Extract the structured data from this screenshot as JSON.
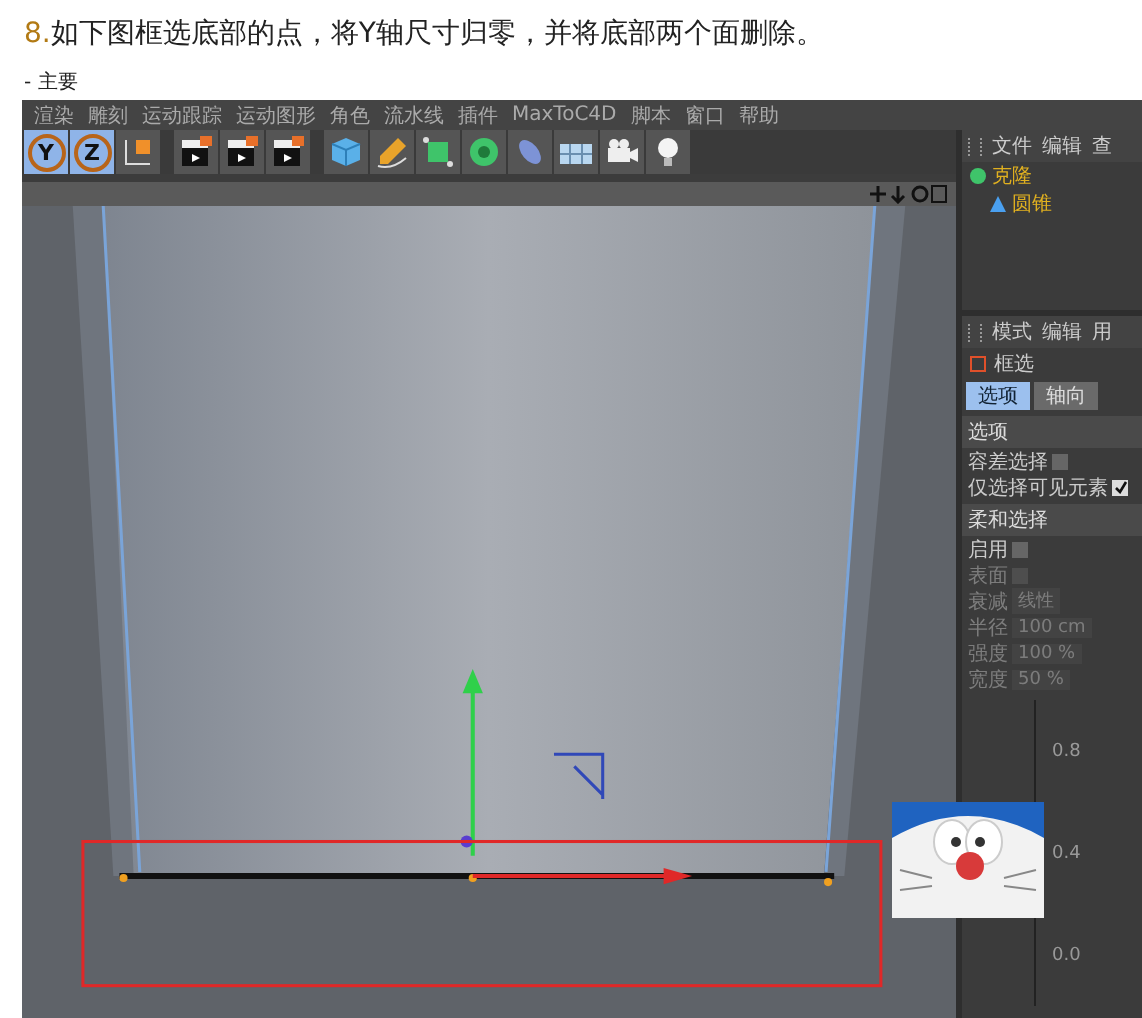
{
  "heading": {
    "number": "8.",
    "text": "如下图框选底部的点，将Y轴尺寸归零，并将底部两个面删除。"
  },
  "caption": "- 主要",
  "menu": [
    "渲染",
    "雕刻",
    "运动跟踪",
    "运动图形",
    "角色",
    "流水线",
    "插件",
    "MaxToC4D",
    "脚本",
    "窗口",
    "帮助"
  ],
  "toolbar": [
    {
      "kind": "axis",
      "label": "Y",
      "selected": true
    },
    {
      "kind": "axis",
      "label": "Z",
      "selected": true
    },
    {
      "kind": "coordinate",
      "selected": false
    },
    {
      "kind": "clapper",
      "selected": false
    },
    {
      "kind": "clapper",
      "selected": false
    },
    {
      "kind": "clapper",
      "selected": false
    },
    {
      "kind": "cube",
      "selected": false
    },
    {
      "kind": "pen",
      "selected": false
    },
    {
      "kind": "box",
      "selected": false
    },
    {
      "kind": "flower",
      "selected": false
    },
    {
      "kind": "capsule",
      "selected": false
    },
    {
      "kind": "floor",
      "selected": false
    },
    {
      "kind": "camera",
      "selected": false
    },
    {
      "kind": "bulb",
      "selected": false
    }
  ],
  "object_manager": {
    "menu": [
      "文件",
      "编辑",
      "查"
    ],
    "objects": [
      {
        "name": "克隆",
        "kind": "cloner",
        "children": [
          {
            "name": "圆锥",
            "kind": "cone"
          }
        ]
      }
    ]
  },
  "attributes": {
    "menu": [
      "模式",
      "编辑",
      "用"
    ],
    "tool": "框选",
    "tabs": [
      {
        "label": "选项",
        "selected": true
      },
      {
        "label": "轴向",
        "selected": false
      }
    ],
    "sections": [
      {
        "title": "选项",
        "rows": [
          {
            "kind": "check",
            "label": "容差选择",
            "checked": false,
            "disabled": false
          },
          {
            "kind": "check",
            "label": "仅选择可见元素",
            "checked": true,
            "disabled": false
          }
        ]
      },
      {
        "title": "柔和选择",
        "rows": [
          {
            "kind": "check",
            "label": "启用",
            "checked": false,
            "disabled": false
          },
          {
            "kind": "check",
            "label": "表面",
            "checked": false,
            "disabled": true
          },
          {
            "kind": "value",
            "label": "衰减",
            "value": "线性",
            "disabled": true
          },
          {
            "kind": "value",
            "label": "半径",
            "value": "100 cm",
            "disabled": true
          },
          {
            "kind": "value",
            "label": "强度",
            "value": "100 %",
            "disabled": true
          },
          {
            "kind": "value",
            "label": "宽度",
            "value": "50 %",
            "disabled": true
          }
        ]
      }
    ],
    "graph_labels": [
      "0.8",
      "0.4",
      "0.0"
    ]
  }
}
